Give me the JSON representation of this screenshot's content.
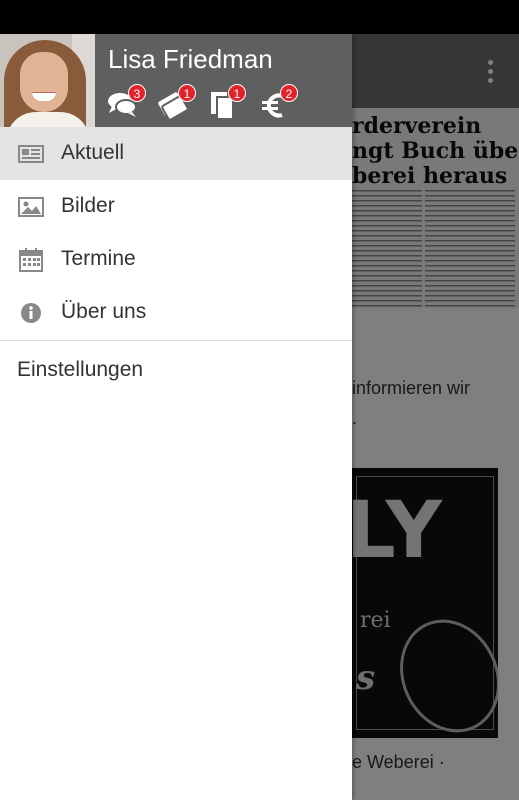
{
  "profile": {
    "name": "Lisa Friedman",
    "badges": {
      "messages": "3",
      "tickets": "1",
      "documents": "1",
      "payments": "2"
    }
  },
  "menu": {
    "items": [
      {
        "label": "Aktuell",
        "icon": "newspaper-icon",
        "active": true
      },
      {
        "label": "Bilder",
        "icon": "image-icon",
        "active": false
      },
      {
        "label": "Termine",
        "icon": "calendar-icon",
        "active": false
      },
      {
        "label": "Über uns",
        "icon": "info-icon",
        "active": false
      }
    ],
    "settings_label": "Einstellungen"
  },
  "background": {
    "headline": "rderverein\nngt Buch über\nberei heraus",
    "text_line1": "informieren wir",
    "text_line2": ".",
    "poster_big": "LY",
    "poster_small": "rei",
    "poster_script": "s",
    "caption": "e Weberei ·"
  },
  "colors": {
    "toolbar": "#6d6d6d",
    "profile_header": "#5f5f5f",
    "badge": "#e2232a",
    "active_item": "#e4e4e4"
  }
}
